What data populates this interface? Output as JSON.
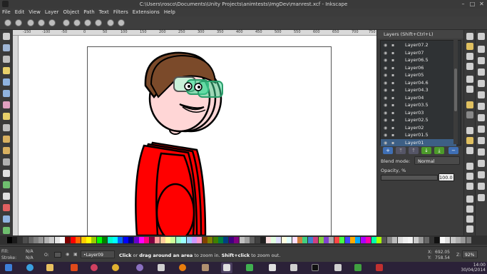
{
  "window": {
    "title": "C:\\Users\\rosco\\Documents\\Unity Projects\\animtests\\ImgDev\\manrest.xcf - Inkscape",
    "minimize_glyph": "–",
    "maximize_glyph": "□",
    "close_glyph": "✕"
  },
  "menu": [
    "File",
    "Edit",
    "View",
    "Layer",
    "Object",
    "Path",
    "Text",
    "Filters",
    "Extensions",
    "Help"
  ],
  "ruler": {
    "ticks": [
      "-150",
      "-100",
      "-50",
      "0",
      "50",
      "100",
      "150",
      "200",
      "250",
      "300",
      "350",
      "400",
      "450",
      "500",
      "550",
      "600",
      "650",
      "700",
      "750"
    ]
  },
  "layers_panel": {
    "title": "Layers (Shift+Ctrl+L)",
    "layers": [
      "Layer07.2",
      "Layer07",
      "Layer06.5",
      "Layer06",
      "Layer05",
      "Layer04.6",
      "Layer04.3",
      "Layer04",
      "Layer03.5",
      "Layer03",
      "Layer02.5",
      "Layer02",
      "Layer01.5",
      "Layer01"
    ],
    "selected_index": 13,
    "blend_mode_label": "Blend mode:",
    "blend_mode_value": "Normal",
    "opacity_label": "Opacity, %",
    "opacity_value": "100.0",
    "buttons": [
      "+",
      "⤒",
      "↑",
      "↓",
      "⤓",
      "−"
    ]
  },
  "status": {
    "fill_label": "Fill:",
    "fill_value": "N/A",
    "stroke_label": "Stroke:",
    "stroke_value": "N/A",
    "opacity_label": "O:",
    "current_layer": "•Layer09",
    "message_bold1": "Click",
    "message_part1": " or ",
    "message_bold2": "drag around an area",
    "message_part2": " to zoom in. ",
    "message_bold3": "Shift+click",
    "message_part3": " to zoom out.",
    "x_label": "X:",
    "x_value": "692.05",
    "y_label": "Y:",
    "y_value": "758.54",
    "z_label": "Z:",
    "zoom_value": "92%"
  },
  "taskbar": {
    "clock_time": "14:00",
    "clock_date": "30/04/2014"
  },
  "colors": {
    "shirt": "#ff0000",
    "hair": "#7b4a2a",
    "skin": "#ffd6d6",
    "glasses": "#3ddc97",
    "chrome_bg": "#3c3c3c",
    "taskbar_bg": "#2b2138"
  }
}
